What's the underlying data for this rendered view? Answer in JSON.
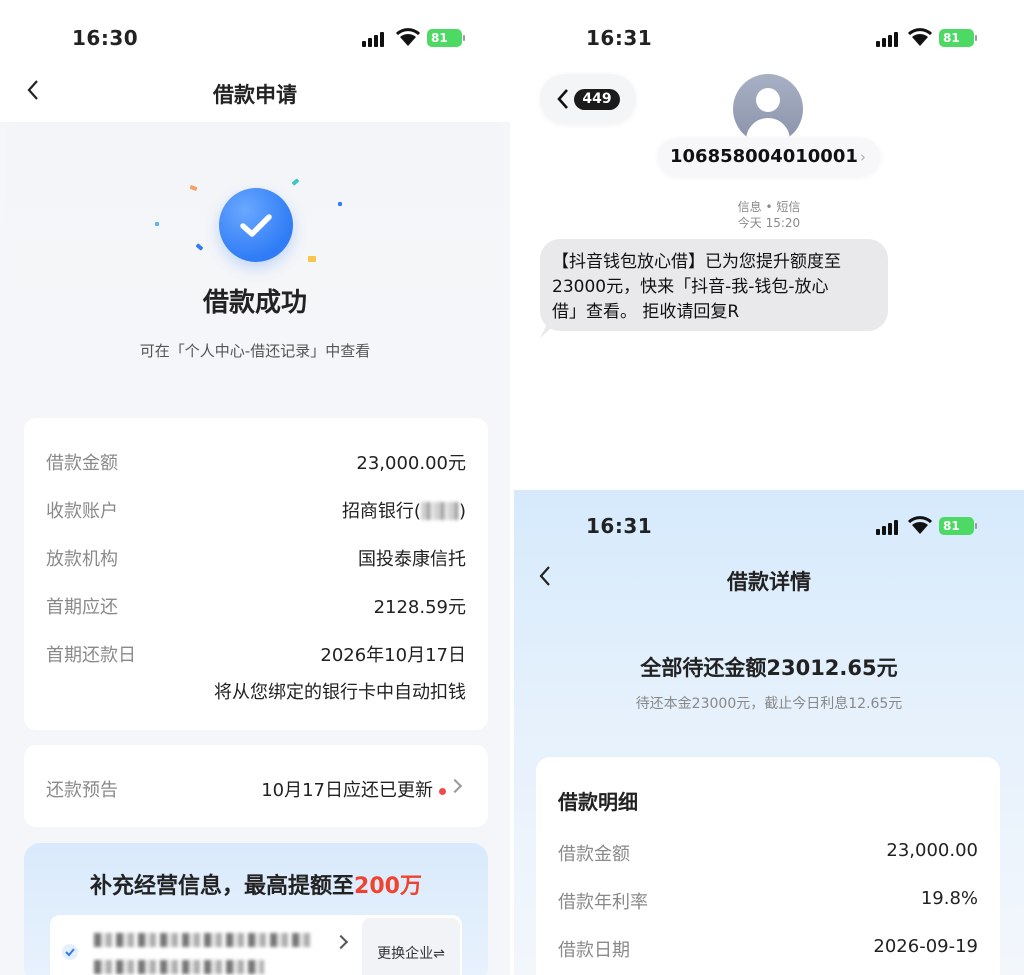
{
  "left": {
    "status": {
      "time": "16:30",
      "battery": "81"
    },
    "nav": {
      "title": "借款申请",
      "back_icon": "chevron-left-icon"
    },
    "success": {
      "icon": "check-circle-icon",
      "title": "借款成功",
      "subtitle": "可在「个人中心-借还记录」中查看"
    },
    "info_rows": [
      {
        "label": "借款金额",
        "value": "23,000.00元"
      },
      {
        "label": "收款账户",
        "value_prefix": "招商银行(",
        "value_suffix": ")"
      },
      {
        "label": "放款机构",
        "value": "国投泰康信托"
      },
      {
        "label": "首期应还",
        "value": "2128.59元"
      },
      {
        "label": "首期还款日",
        "value": "2026年10月17日"
      }
    ],
    "auto_debit_note": "将从您绑定的银行卡中自动扣钱",
    "repay_notice": {
      "label": "还款预告",
      "value": "10月17日应还已更新"
    },
    "promo": {
      "title_prefix": "补充经营信息，最高提额至",
      "title_highlight": "200万",
      "switch_label": "更换企业⇌"
    }
  },
  "sms": {
    "status": {
      "time": "16:31",
      "battery": "81"
    },
    "unread_badge": "449",
    "sender_number": "106858004010001",
    "sender_arrow": "›",
    "channel": "信息 • 短信",
    "timestamp": "今天 15:20",
    "message_lines": [
      "【抖音钱包放心借】已为您提升额度至",
      "23000元，快来「抖音-我-钱包-放心",
      "借」查看。 拒收请回复R"
    ]
  },
  "detail": {
    "status": {
      "time": "16:31",
      "battery": "81"
    },
    "nav": {
      "title": "借款详情"
    },
    "total_due": "全部待还金额23012.65元",
    "total_sub": "待还本金23000元，截止今日利息12.65元",
    "section_title": "借款明细",
    "rows": [
      {
        "label": "借款金额",
        "value": "23,000.00"
      },
      {
        "label": "借款年利率",
        "value": "19.8%"
      },
      {
        "label": "借款日期",
        "value": "2026-09-19"
      }
    ]
  },
  "colors": {
    "accent_blue": "#2f7cf6",
    "highlight_red": "#f0432f",
    "battery_green": "#4cd964"
  }
}
